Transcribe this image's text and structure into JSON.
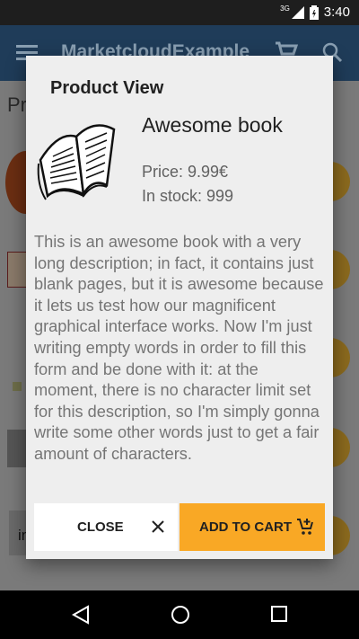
{
  "status_bar": {
    "network": "3G",
    "time": "3:40"
  },
  "app_bar": {
    "title": "MarketcloudExample",
    "icons": [
      "menu-icon",
      "cart-icon",
      "search-icon"
    ]
  },
  "background_list": {
    "heading_fragment": "Pr",
    "row_fragment": "in"
  },
  "dialog": {
    "title": "Product View",
    "product_name": "Awesome book",
    "price": "Price: 9.99€",
    "stock": "In stock: 999",
    "description": "This is an awesome book with a very long description; in fact, it contains just blank pages, but it is awesome because it lets us test how our magnificent graphical interface works. Now I'm just writing empty words in order to fill this form and be done with it: at the moment, there is no character limit set for this description, so I'm simply gonna write some other words just to get a fair amount of characters.",
    "close_label": "CLOSE",
    "add_to_cart_label": "ADD TO CART"
  },
  "colors": {
    "accent": "#f9a825",
    "primary": "#1f3c59",
    "dialog_bg": "#eeeeee"
  }
}
